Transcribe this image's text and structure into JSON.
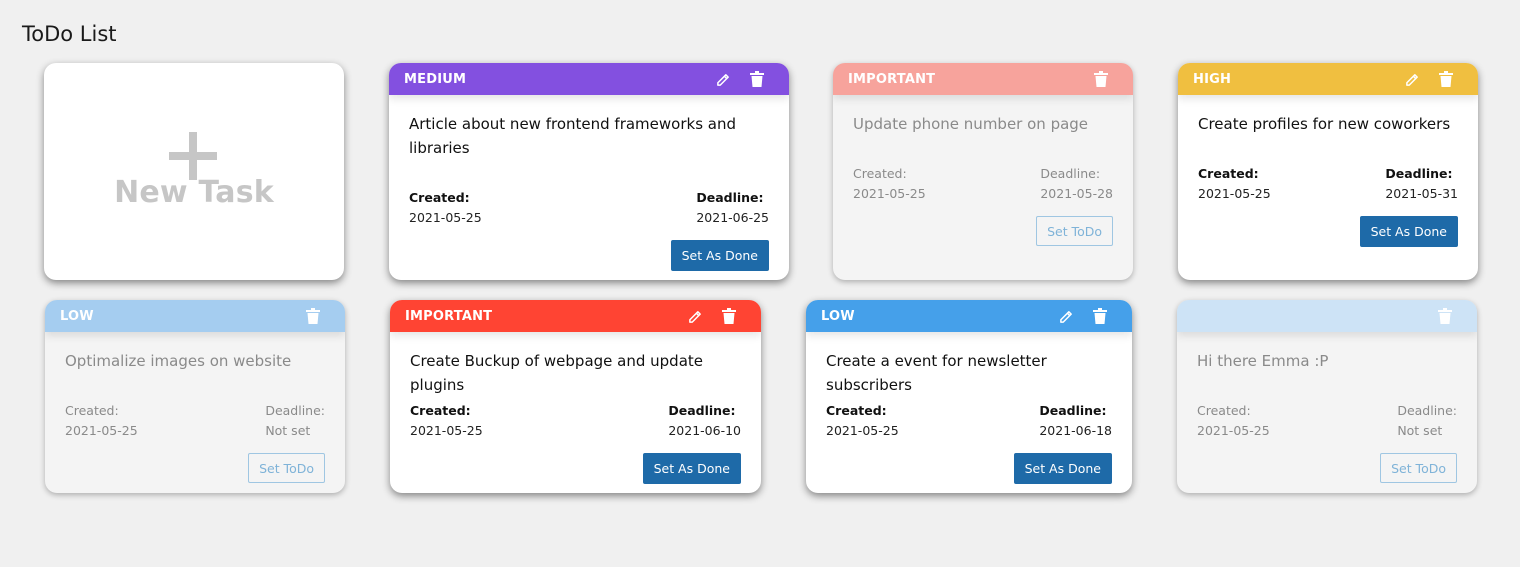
{
  "page": {
    "title": "ToDo List"
  },
  "new_task": {
    "label": "New Task",
    "icon": "plus-icon"
  },
  "labels": {
    "created": "Created:",
    "deadline": "Deadline:"
  },
  "buttons": {
    "set_done": "Set As Done",
    "set_todo": "Set ToDo"
  },
  "colors": {
    "medium": "#8350e0",
    "important": "#ff4433",
    "important_faded": "#f7a39c",
    "high": "#f0bf40",
    "low": "#45a0ea",
    "low_faded": "#a5cdf0",
    "none_faded": "#cde3f6",
    "button": "#1e6aa8"
  },
  "tasks": [
    {
      "priority": "MEDIUM",
      "title": "Article about new frontend frameworks and libraries",
      "created": "2021-05-25",
      "deadline": "2021-06-25",
      "status": "todo",
      "action": "Set As Done"
    },
    {
      "priority": "IMPORTANT",
      "title": "Update phone number on page",
      "created": "2021-05-25",
      "deadline": "2021-05-28",
      "status": "done",
      "action": "Set ToDo"
    },
    {
      "priority": "HIGH",
      "title": "Create profiles for new coworkers",
      "created": "2021-05-25",
      "deadline": "2021-05-31",
      "status": "todo",
      "action": "Set As Done"
    },
    {
      "priority": "LOW",
      "title": "Optimalize images on website",
      "created": "2021-05-25",
      "deadline": "Not set",
      "status": "done",
      "action": "Set ToDo"
    },
    {
      "priority": "IMPORTANT",
      "title": "Create Buckup of webpage and update plugins",
      "created": "2021-05-25",
      "deadline": "2021-06-10",
      "status": "todo",
      "action": "Set As Done"
    },
    {
      "priority": "LOW",
      "title": "Create a event for newsletter subscribers",
      "created": "2021-05-25",
      "deadline": "2021-06-18",
      "status": "todo",
      "action": "Set As Done"
    },
    {
      "priority": "",
      "title": "Hi there Emma :P",
      "created": "2021-05-25",
      "deadline": "Not set",
      "status": "done",
      "action": "Set ToDo"
    }
  ]
}
